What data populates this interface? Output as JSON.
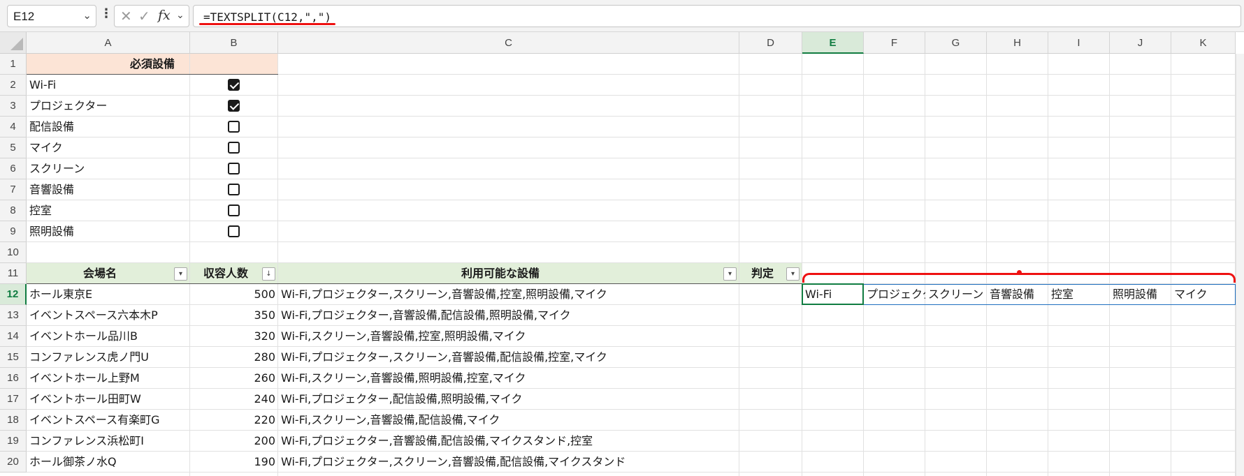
{
  "formula_bar": {
    "name_box": "E12",
    "formula": "=TEXTSPLIT(C12,\",\")",
    "fx_label": "fx"
  },
  "columns": [
    "A",
    "B",
    "C",
    "D",
    "E",
    "F",
    "G",
    "H",
    "I",
    "J",
    "K"
  ],
  "rows": [
    "1",
    "2",
    "3",
    "4",
    "5",
    "6",
    "7",
    "8",
    "9",
    "10",
    "11",
    "12",
    "13",
    "14",
    "15",
    "16",
    "17",
    "18",
    "19",
    "20"
  ],
  "required": {
    "header": "必須設備",
    "items": [
      {
        "label": "Wi-Fi",
        "checked": true
      },
      {
        "label": "プロジェクター",
        "checked": true
      },
      {
        "label": "配信設備",
        "checked": false
      },
      {
        "label": "マイク",
        "checked": false
      },
      {
        "label": "スクリーン",
        "checked": false
      },
      {
        "label": "音響設備",
        "checked": false
      },
      {
        "label": "控室",
        "checked": false
      },
      {
        "label": "照明設備",
        "checked": false
      }
    ]
  },
  "table": {
    "headers": [
      "会場名",
      "収容人数",
      "利用可能な設備",
      "判定"
    ],
    "rows": [
      {
        "name": "ホール東京E",
        "capacity": "500",
        "equipment": "Wi-Fi,プロジェクター,スクリーン,音響設備,控室,照明設備,マイク"
      },
      {
        "name": "イベントスペース六本木P",
        "capacity": "350",
        "equipment": "Wi-Fi,プロジェクター,音響設備,配信設備,照明設備,マイク"
      },
      {
        "name": "イベントホール品川B",
        "capacity": "320",
        "equipment": "Wi-Fi,スクリーン,音響設備,控室,照明設備,マイク"
      },
      {
        "name": "コンファレンス虎ノ門U",
        "capacity": "280",
        "equipment": "Wi-Fi,プロジェクター,スクリーン,音響設備,配信設備,控室,マイク"
      },
      {
        "name": "イベントホール上野M",
        "capacity": "260",
        "equipment": "Wi-Fi,スクリーン,音響設備,照明設備,控室,マイク"
      },
      {
        "name": "イベントホール田町W",
        "capacity": "240",
        "equipment": "Wi-Fi,プロジェクター,配信設備,照明設備,マイク"
      },
      {
        "name": "イベントスペース有楽町G",
        "capacity": "220",
        "equipment": "Wi-Fi,スクリーン,音響設備,配信設備,マイク"
      },
      {
        "name": "コンファレンス浜松町I",
        "capacity": "200",
        "equipment": "Wi-Fi,プロジェクター,音響設備,配信設備,マイクスタンド,控室"
      },
      {
        "name": "ホール御茶ノ水Q",
        "capacity": "190",
        "equipment": "Wi-Fi,プロジェクター,スクリーン,音響設備,配信設備,マイクスタンド"
      }
    ]
  },
  "spill": [
    "Wi-Fi",
    "プロジェクター",
    "スクリーン",
    "音響設備",
    "控室",
    "照明設備",
    "マイク"
  ],
  "colors": {
    "accent": "#107c41",
    "highlight_red": "#ee1111",
    "header_green": "#e2efda",
    "header_peach": "#fce4d6"
  }
}
